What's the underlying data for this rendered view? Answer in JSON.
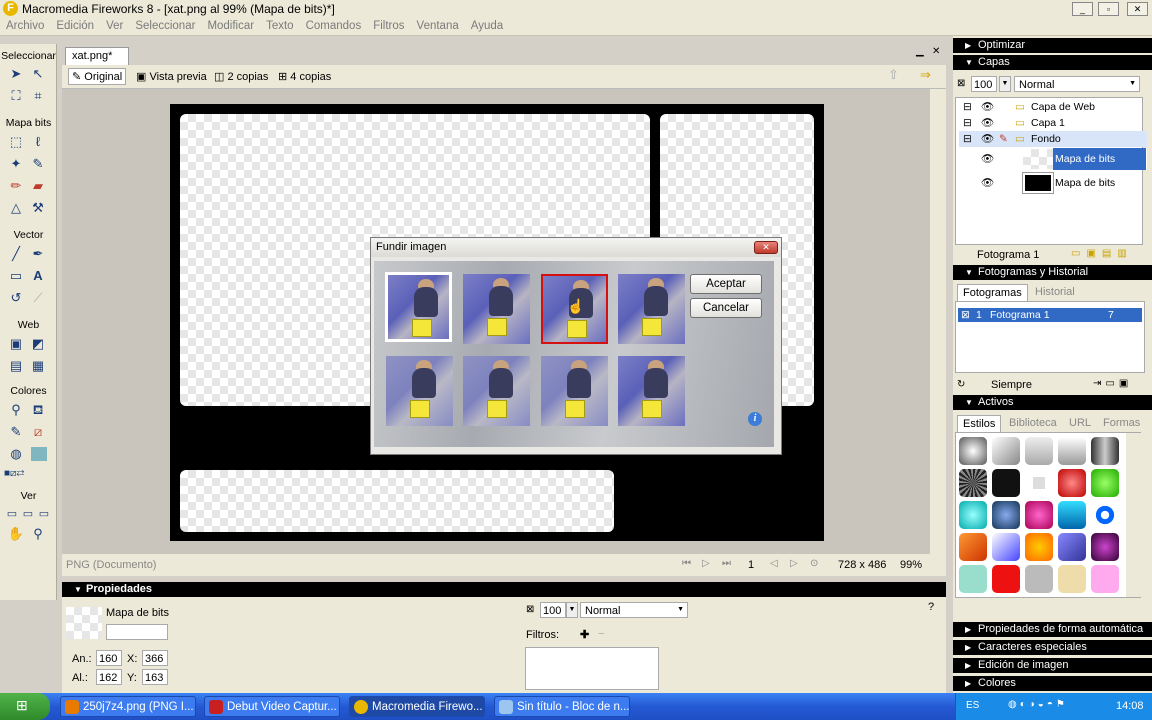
{
  "window": {
    "title": "Macromedia Fireworks 8 - [xat.png al  99% (Mapa de bits)*]"
  },
  "menu": [
    "Archivo",
    "Edición",
    "Ver",
    "Seleccionar",
    "Modificar",
    "Texto",
    "Comandos",
    "Filtros",
    "Ventana",
    "Ayuda"
  ],
  "tools": {
    "select": "Seleccionar",
    "bitmap": "Mapa bits",
    "vector": "Vector",
    "web": "Web",
    "colors": "Colores",
    "view": "Ver"
  },
  "document": {
    "tab": "xat.png*",
    "views": [
      "Original",
      "Vista previa",
      "2 copias",
      "4 copias"
    ],
    "status_format": "PNG (Documento)",
    "frame": "1",
    "size": "728 x 486",
    "zoom": "99%"
  },
  "dialog": {
    "title": "Fundir imagen",
    "ok": "Aceptar",
    "cancel": "Cancelar"
  },
  "properties": {
    "header": "Propiedades",
    "object_name": "Mapa de bits",
    "width_label": "An.:",
    "width": "160",
    "height_label": "Al.:",
    "height": "162",
    "x_label": "X:",
    "x": "366",
    "y_label": "Y:",
    "y": "163",
    "opacity": "100",
    "blend": "Normal",
    "filters_label": "Filtros:"
  },
  "right_panel": {
    "optimize": "Optimizar",
    "layers": "Capas",
    "layer_opacity": "100",
    "layer_blend": "Normal",
    "layer_items": [
      "Capa de Web",
      "Capa 1",
      "Fondo",
      "Mapa de bits",
      "Mapa de bits"
    ],
    "frame_label": "Fotograma 1",
    "frames_history": "Fotogramas y Historial",
    "tab_frames": "Fotogramas",
    "tab_history": "Historial",
    "frame_row_num": "1",
    "frame_row_name": "Fotograma 1",
    "frame_row_delay": "7",
    "loop": "Siempre",
    "assets": "Activos",
    "asset_tabs": [
      "Estilos",
      "Biblioteca",
      "URL",
      "Formas"
    ],
    "collapsed": [
      "Propiedades de forma automática",
      "Caracteres especiales",
      "Edición de imagen",
      "Colores"
    ]
  },
  "taskbar": {
    "tasks": [
      "250j7z4.png (PNG I...",
      "Debut Video Captur...",
      "Macromedia Firewo...",
      "Sin título - Bloc de n..."
    ],
    "lang": "ES",
    "clock": "14:08"
  },
  "colors": {
    "selection": "#316ac5",
    "taskbar": "#2459d4"
  }
}
